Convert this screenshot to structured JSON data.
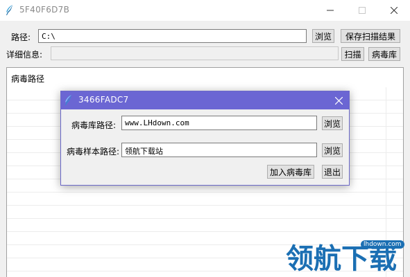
{
  "window": {
    "title": "5F40F6D7B",
    "controls": {
      "minimize": "minimize-icon",
      "maximize": "maximize-icon",
      "close": "close-icon"
    }
  },
  "form": {
    "path_label": "路径:",
    "path_value": "C:\\",
    "browse_label": "浏览",
    "save_results_label": "保存扫描结果",
    "details_label": "详细信息:",
    "details_value": "",
    "scan_label": "扫描",
    "virus_db_label": "病毒库"
  },
  "list": {
    "column_header": "病毒路径"
  },
  "dialog": {
    "title": "3466FADC7",
    "db_path_label": "病毒库路径:",
    "db_path_value": "www.LHdown.com",
    "sample_path_label": "病毒样本路径:",
    "sample_path_value": "领航下载站",
    "browse_label": "浏览",
    "add_label": "加入病毒库",
    "exit_label": "退出",
    "accent": "#6b66d3"
  },
  "watermark": {
    "text": "领航下载",
    "badge": "lhdown.com",
    "color": "#1b6fb3"
  }
}
